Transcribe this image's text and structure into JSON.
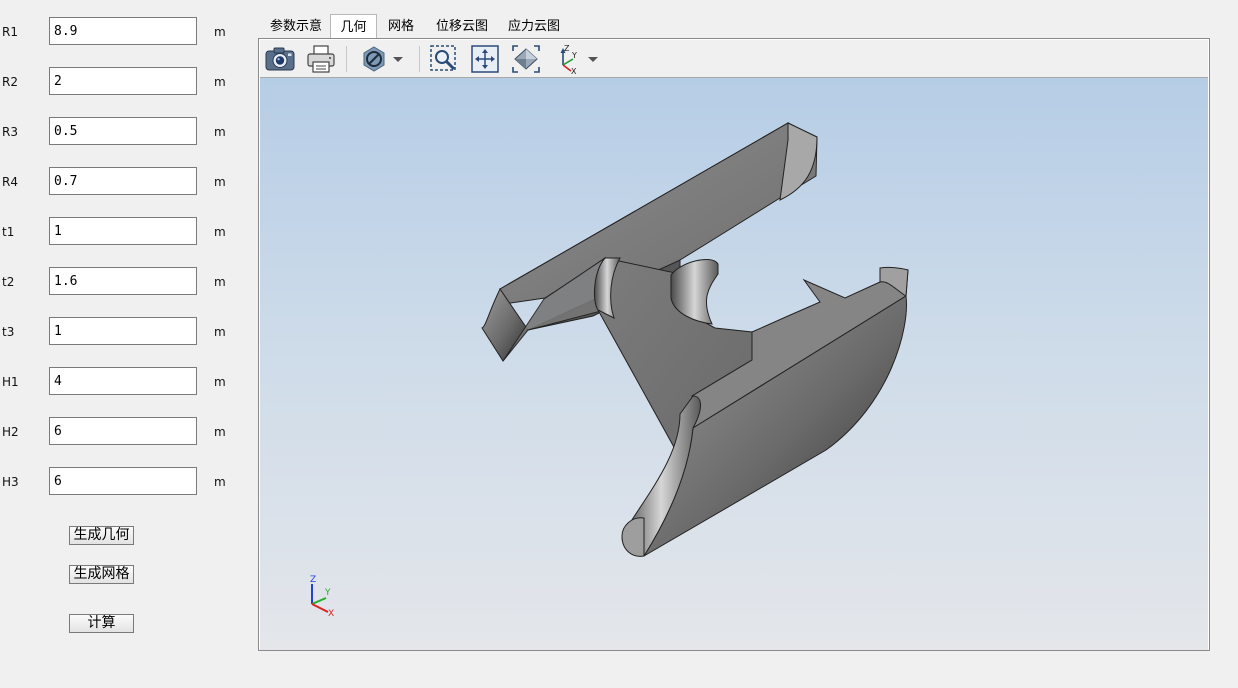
{
  "params": [
    {
      "label": "R1",
      "value": "8.9",
      "unit": "m"
    },
    {
      "label": "R2",
      "value": "2",
      "unit": "m"
    },
    {
      "label": "R3",
      "value": "0.5",
      "unit": "m"
    },
    {
      "label": "R4",
      "value": "0.7",
      "unit": "m"
    },
    {
      "label": "t1",
      "value": "1",
      "unit": "m"
    },
    {
      "label": "t2",
      "value": "1.6",
      "unit": "m"
    },
    {
      "label": "t3",
      "value": "1",
      "unit": "m"
    },
    {
      "label": "H1",
      "value": "4",
      "unit": "m"
    },
    {
      "label": "H2",
      "value": "6",
      "unit": "m"
    },
    {
      "label": "H3",
      "value": "6",
      "unit": "m"
    }
  ],
  "buttons": {
    "gen_geometry": "生成几何",
    "gen_mesh": "生成网格",
    "compute": "计算"
  },
  "tabs": [
    {
      "label": "参数示意"
    },
    {
      "label": "几何"
    },
    {
      "label": "网格"
    },
    {
      "label": "位移云图"
    },
    {
      "label": "应力云图"
    }
  ],
  "active_tab": "几何",
  "toolbar": {
    "icons": [
      "camera-icon",
      "print-icon",
      "display-mode-icon",
      "dropdown-arrow-icon",
      "zoom-window-icon",
      "fit-all-icon",
      "isometric-view-icon",
      "axis-view-icon",
      "dropdown-arrow-icon"
    ]
  },
  "triad": {
    "x": "X",
    "y": "Y",
    "z": "Z"
  },
  "colors": {
    "viewport_top": "#b6cde6",
    "viewport_bottom": "#e4e6ea",
    "model_gray": "#7b7b7b",
    "axis_x": "#e02020",
    "axis_y": "#20b020",
    "axis_z": "#2040e0"
  }
}
